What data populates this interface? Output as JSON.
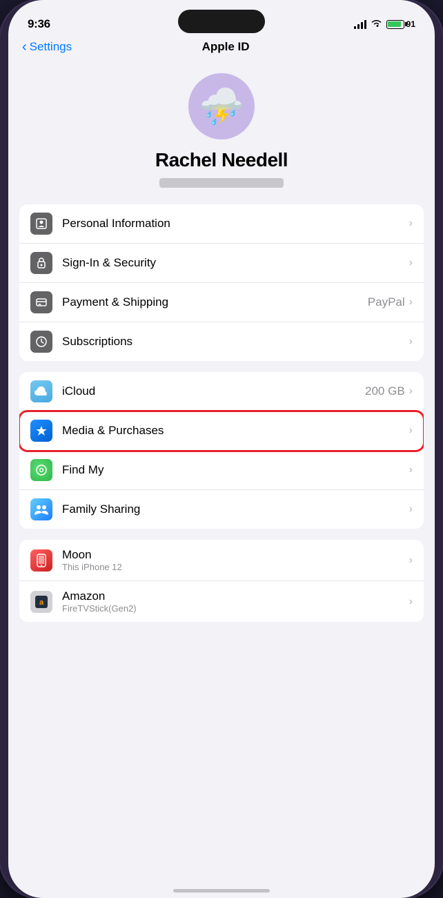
{
  "statusBar": {
    "time": "9:36",
    "battery": "91"
  },
  "nav": {
    "backLabel": "Settings",
    "title": "Apple ID"
  },
  "profile": {
    "name": "Rachel Needell",
    "avatar": "🌧️"
  },
  "group1": {
    "items": [
      {
        "id": "personal-info",
        "icon": "👤",
        "iconColor": "icon-gray",
        "label": "Personal Information",
        "value": "",
        "chevron": "›"
      },
      {
        "id": "signin-security",
        "icon": "🔑",
        "iconColor": "icon-gray",
        "label": "Sign-In & Security",
        "value": "",
        "chevron": "›"
      },
      {
        "id": "payment-shipping",
        "icon": "💳",
        "iconColor": "icon-gray",
        "label": "Payment & Shipping",
        "value": "PayPal",
        "chevron": "›"
      },
      {
        "id": "subscriptions",
        "icon": "↻",
        "iconColor": "icon-gray",
        "label": "Subscriptions",
        "value": "",
        "chevron": "›"
      }
    ]
  },
  "group2": {
    "items": [
      {
        "id": "icloud",
        "icon": "☁️",
        "iconColor": "icon-icloud",
        "label": "iCloud",
        "value": "200 GB",
        "chevron": "›"
      },
      {
        "id": "media-purchases",
        "icon": "A",
        "iconColor": "icon-appstore",
        "label": "Media & Purchases",
        "value": "",
        "chevron": "›",
        "highlighted": true
      },
      {
        "id": "find-my",
        "icon": "⊙",
        "iconColor": "icon-findmy",
        "label": "Find My",
        "value": "",
        "chevron": "›"
      },
      {
        "id": "family-sharing",
        "icon": "👥",
        "iconColor": "icon-family",
        "label": "Family Sharing",
        "value": "",
        "chevron": "›"
      }
    ]
  },
  "group3": {
    "items": [
      {
        "id": "moon-app",
        "icon": "📱",
        "iconColor": "moon-icon",
        "label": "Moon",
        "subtitle": "This iPhone 12",
        "chevron": "›"
      },
      {
        "id": "amazon-app",
        "icon": "amz",
        "iconColor": "amazon-icon",
        "label": "Amazon",
        "subtitle": "FireTVStick(Gen2)",
        "chevron": "›"
      }
    ]
  }
}
